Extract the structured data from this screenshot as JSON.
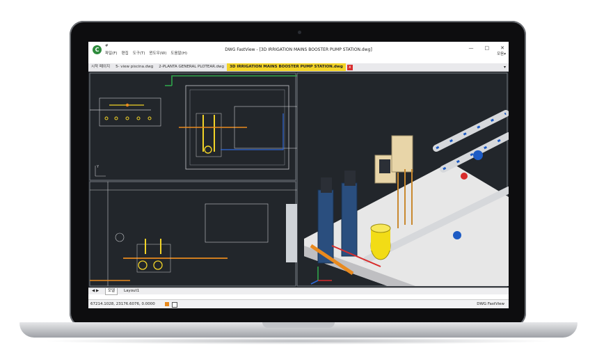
{
  "app": {
    "title": "DWG FastView - [3D IRRIGATION MAINS BOOSTER PUMP STATION.dwg]",
    "logo_icon": "dwg-fastview-logo-icon",
    "window_minimize": "—",
    "window_maximize": "□",
    "window_close": "✕",
    "favorites_label": "모음▾"
  },
  "menu": {
    "items": [
      "파일(F)",
      "편집",
      "도구(T)",
      "윈도우(W)",
      "도움말(H)"
    ],
    "pin": "#"
  },
  "tabs": {
    "items": [
      {
        "label": "시작 페이지"
      },
      {
        "label": "5- view piscina.dwg"
      },
      {
        "label": "2-PLANTA GENERAL PLOTEAR.dwg"
      },
      {
        "label": "3D IRRIGATION MAINS BOOSTER PUMP STATION.dwg",
        "active": true
      }
    ],
    "close_glyph": "x",
    "dropdown_glyph": "▾"
  },
  "sheet_tabs": {
    "nav": "◀ ▶",
    "items": [
      "모델",
      "Layout1"
    ]
  },
  "status": {
    "coordinates": "67214.1028, 23176.6076, 0.0000",
    "brand": "DWG FastView"
  },
  "colors": {
    "canvas_bg": "#22262b",
    "active_tab": "#f3d427",
    "close_tab": "#d82c2c",
    "floor": "#e7e7e7",
    "pipe_blue": "#1d5bc4",
    "pump_blue": "#2a4e7e",
    "tank_yellow": "#f2dc16",
    "cabinet": "#e8d5a8",
    "cad_green": "#2fa44a",
    "cad_orange": "#e98a1e"
  }
}
